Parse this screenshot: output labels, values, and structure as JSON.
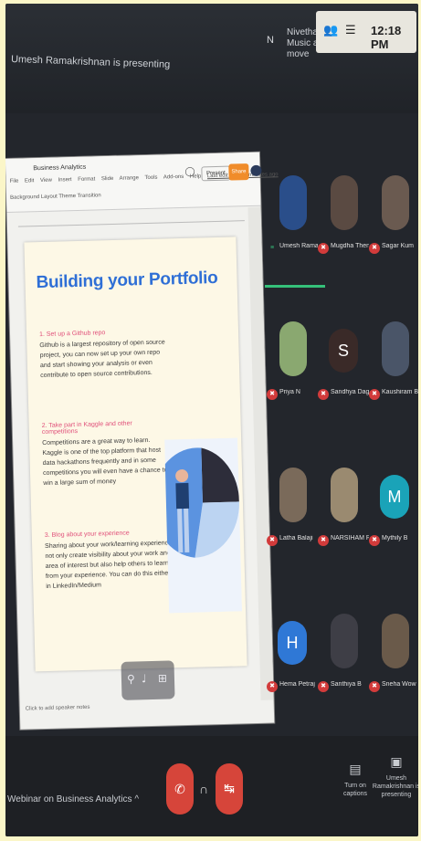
{
  "top": {
    "presenting_label": "Umesh Ramakrishnan is presenting",
    "presenter_initial": "N",
    "presenter_name": "Nivetha Music and Fit move",
    "clock": "12:18 PM"
  },
  "doc": {
    "title": "Business Analytics",
    "menu": [
      "File",
      "Edit",
      "View",
      "Insert",
      "Format",
      "Slide",
      "Arrange",
      "Tools",
      "Add-ons",
      "Help",
      "Last edit was 22 minutes ago"
    ],
    "tools": "Background  Layout  Theme  Transition",
    "present_label": "Present",
    "share_label": "Share",
    "footer": "Click to add speaker notes"
  },
  "slide": {
    "title": "Building your Portfolio",
    "points": [
      {
        "head": "1. Set up a Github repo",
        "body": "Github is a largest repository of open source project, you can now set up your own repo and start showing your analysis or even contribute to open source contributions."
      },
      {
        "head": "2. Take part in Kaggle and other competitions",
        "body": "Competitions are a great way to learn. Kaggle is one of the top platform that host data hackathons frequently and in some competitions you will even have a chance to win a large sum of money"
      },
      {
        "head": "3. Blog about your experience",
        "body": "Sharing about your work/learning experience not only create visibility about your work and area of interest but also help others to learn from your experience. You can do this either in LinkedIn/Medium"
      }
    ]
  },
  "participants": [
    {
      "name": "Umesh Ramakrish...",
      "initial": "",
      "color": "#2a4e8a"
    },
    {
      "name": "Mugdha Thenge",
      "initial": "",
      "color": "#5a4a42"
    },
    {
      "name": "Sagar Kum",
      "initial": "",
      "color": "#6a5a50"
    },
    {
      "name": "Priya N",
      "initial": "",
      "color": "#8aa870"
    },
    {
      "name": "Sandhya Dagi",
      "initial": "S",
      "color": "#3a2a28"
    },
    {
      "name": "Kaushiram B",
      "initial": "",
      "color": "#4a5568"
    },
    {
      "name": "Latha Balaji",
      "initial": "",
      "color": "#7a6a5a"
    },
    {
      "name": "NARSIHAM PAVA...",
      "initial": "",
      "color": "#9a8a70"
    },
    {
      "name": "Mythily B",
      "initial": "M",
      "color": "#1aa3b8"
    },
    {
      "name": "Hema Petraj",
      "initial": "H",
      "color": "#2f78d6"
    },
    {
      "name": "Santhiya B",
      "initial": "",
      "color": "#3e3e46"
    },
    {
      "name": "Sneha Wow",
      "initial": "",
      "color": "#6a5a4a"
    }
  ],
  "bottom": {
    "meeting_title": "Webinar on Business Analytics  ^",
    "captions_label": "Turn on captions",
    "presenting_label": "Umesh Ramakrishnan is presenting"
  },
  "colors": {
    "accent_blue": "#2f6fd6",
    "end_call": "#d6453a",
    "active": "#35c07a",
    "pink": "#e0507a"
  }
}
